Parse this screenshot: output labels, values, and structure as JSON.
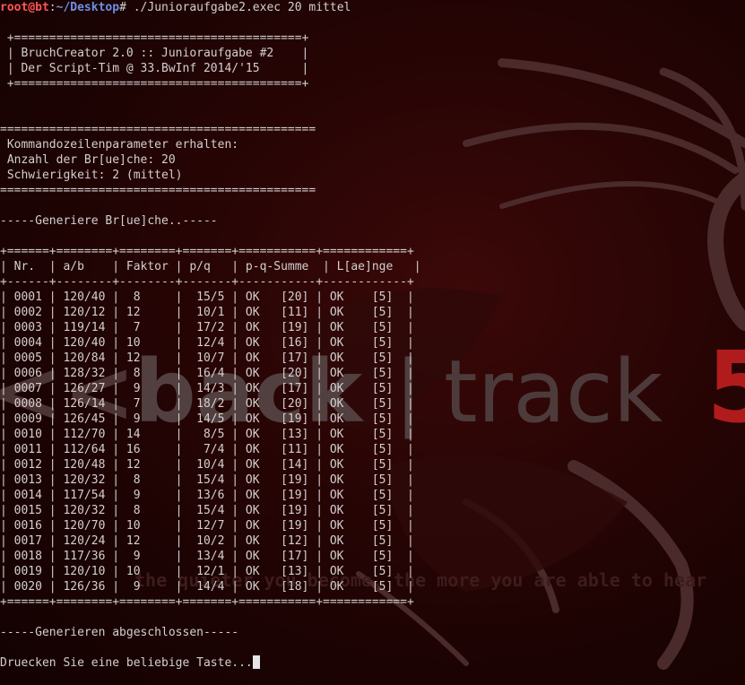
{
  "prompt": {
    "user_host": "root@bt",
    "sep": ":",
    "path": "~/Desktop",
    "symbol": "# ",
    "command": "./Junioraufgabe2.exec 20 mittel"
  },
  "banner": [
    " +=========================================+",
    " | BruchCreator 2.0 :: Junioraufgabe #2    |",
    " | Der Script-Tim @ 33.BwInf 2014/'15      |",
    " +=========================================+"
  ],
  "params": {
    "rule": "=============================================",
    "title": " Kommandozeilenparameter erhalten:",
    "count": " Anzahl der Br[ue]che: 20",
    "difficulty": " Schwierigkeit: 2 (mittel)"
  },
  "generating": "-----Generiere Br[ue]che..-----",
  "table": {
    "rule_top": "+======+========+========+=======+===========+============+",
    "header": "| Nr.  | a/b    | Faktor | p/q   | p-q-Summe  | L[ae]nge   |",
    "rule_mid": "+------+--------+--------+-------+-----------+------------+",
    "rows": [
      "| 0001 | 120/40 |  8     |  15/5 | OK   [20] | OK    [5]  |",
      "| 0002 | 120/12 | 12     |  10/1 | OK   [11] | OK    [5]  |",
      "| 0003 | 119/14 |  7     |  17/2 | OK   [19] | OK    [5]  |",
      "| 0004 | 120/40 | 10     |  12/4 | OK   [16] | OK    [5]  |",
      "| 0005 | 120/84 | 12     |  10/7 | OK   [17] | OK    [5]  |",
      "| 0006 | 128/32 |  8     |  16/4 | OK   [20] | OK    [5]  |",
      "| 0007 | 126/27 |  9     |  14/3 | OK   [17] | OK    [5]  |",
      "| 0008 | 126/14 |  7     |  18/2 | OK   [20] | OK    [5]  |",
      "| 0009 | 126/45 |  9     |  14/5 | OK   [19] | OK    [5]  |",
      "| 0010 | 112/70 | 14     |   8/5 | OK   [13] | OK    [5]  |",
      "| 0011 | 112/64 | 16     |   7/4 | OK   [11] | OK    [5]  |",
      "| 0012 | 120/48 | 12     |  10/4 | OK   [14] | OK    [5]  |",
      "| 0013 | 120/32 |  8     |  15/4 | OK   [19] | OK    [5]  |",
      "| 0014 | 117/54 |  9     |  13/6 | OK   [19] | OK    [5]  |",
      "| 0015 | 120/32 |  8     |  15/4 | OK   [19] | OK    [5]  |",
      "| 0016 | 120/70 | 10     |  12/7 | OK   [19] | OK    [5]  |",
      "| 0017 | 120/24 | 12     |  10/2 | OK   [12] | OK    [5]  |",
      "| 0018 | 117/36 |  9     |  13/4 | OK   [17] | OK    [5]  |",
      "| 0019 | 120/10 | 10     |  12/1 | OK   [13] | OK    [5]  |",
      "| 0020 | 126/36 |  9     |  14/4 | OK   [18] | OK    [5]  |"
    ],
    "rule_bottom": "+======+========+========+=======+===========+============+"
  },
  "done": "-----Generieren abgeschlossen-----",
  "press_key": "Druecken Sie eine beliebige Taste...",
  "wallpaper": {
    "logo_bracket": "<<",
    "logo_back": "back",
    "logo_bar": "|",
    "logo_track": "track",
    "logo_version": "5",
    "tagline": "the quieter you become, the more you are able to hear",
    "colors": {
      "logo": "#5a4040",
      "tagline": "#3a1a1a",
      "dragon": "#4a2a2a",
      "accent": "#c42020"
    }
  },
  "colors": {
    "background": "#1a0303",
    "text": "#d4cfcf",
    "prompt_user": "#ff5555",
    "prompt_path": "#6f8fe6"
  }
}
